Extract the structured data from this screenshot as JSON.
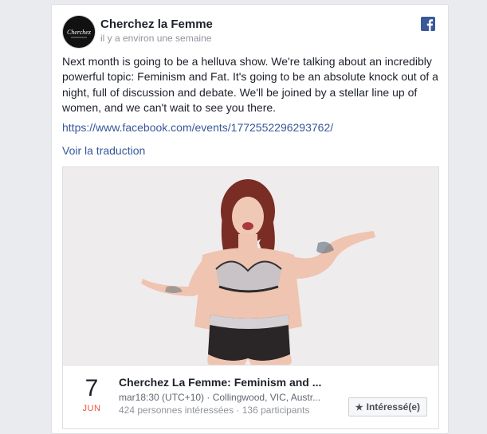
{
  "post": {
    "page_name": "Cherchez la Femme",
    "avatar_text": "Cherchez",
    "timestamp": "il y a environ une semaine",
    "text": "Next month is going to be a helluva show. We're talking about an incredibly powerful topic: Feminism and Fat. It's going to be an absolute knock out of a night, full of discussion and debate. We'll be joined by a stellar line up of women, and we can't wait to see you there.",
    "link": "https://www.facebook.com/events/1772552296293762/",
    "translate_label": "Voir la traduction"
  },
  "event": {
    "day": "7",
    "month": "JUN",
    "title": "Cherchez La Femme: Feminism and ...",
    "meta": "mar18:30 (UTC+10) · Collingwood, VIC, Austr...",
    "stats": "424 personnes intéressées · 136 participants",
    "interested_label": "Intéressé(e)"
  },
  "colors": {
    "link": "#365899",
    "facebook_brand": "#3b5998",
    "month_red": "#e9573e"
  },
  "icons": {
    "facebook": "facebook-icon",
    "interested": "star-icon"
  }
}
